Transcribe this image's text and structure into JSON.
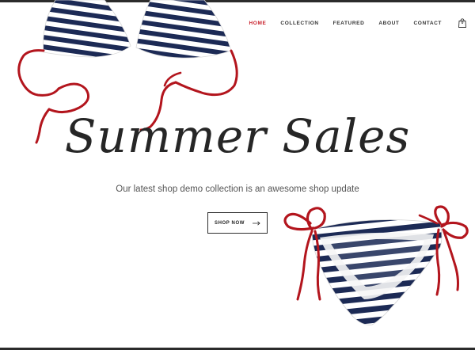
{
  "nav": {
    "items": [
      {
        "label": "HOME",
        "active": true
      },
      {
        "label": "COLLECTION",
        "active": false
      },
      {
        "label": "FEATURED",
        "active": false
      },
      {
        "label": "ABOUT",
        "active": false
      },
      {
        "label": "CONTACT",
        "active": false
      }
    ],
    "cart_count": "0",
    "active_color": "#c8202b"
  },
  "hero": {
    "title": "Summer Sales",
    "subtitle": "Our latest shop demo collection is an awesome shop update",
    "button_label": "SHOP NOW",
    "button_icon": "arrow-right-icon"
  },
  "images": {
    "top": "striped-bikini-top",
    "bottom": "striped-bikini-bottom"
  },
  "colors": {
    "stripe": "#1c2a55",
    "string": "#b3151d"
  }
}
